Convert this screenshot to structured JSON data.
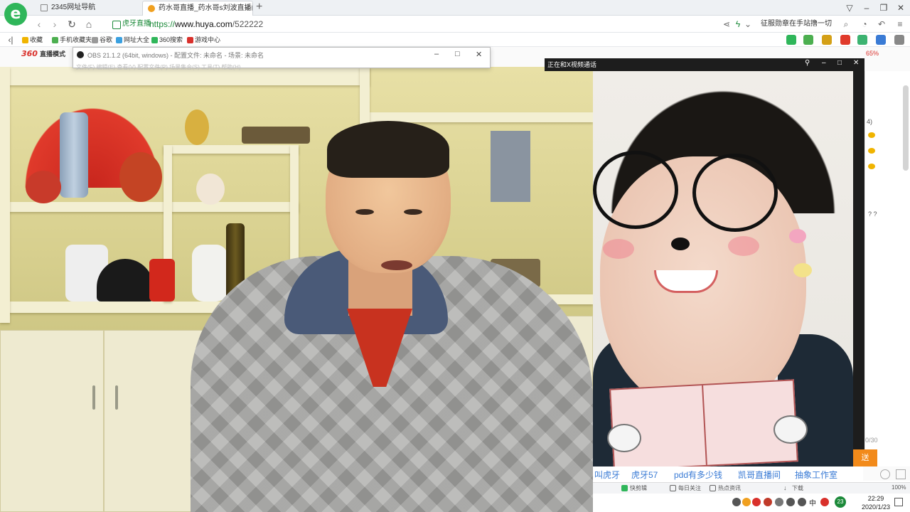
{
  "tabs": [
    {
      "label": "2345网址导航"
    },
    {
      "label": "药水哥直播_药水哥s刘波直播间_"
    }
  ],
  "address": {
    "site_badge": "虎牙直播",
    "url_scheme": "https://",
    "url_domain": "www.huya.com",
    "url_path": "/522222",
    "right_text": "征服勋章在手站撸一切"
  },
  "bookmarks": [
    {
      "label": "收藏"
    },
    {
      "label": "手机收藏夹"
    },
    {
      "label": "谷歌"
    },
    {
      "label": "网址大全"
    },
    {
      "label": "360搜索"
    },
    {
      "label": "游戏中心"
    }
  ],
  "page": {
    "logo": "360",
    "logo_sub": "直播模式",
    "percent": "65%"
  },
  "obs": {
    "title": "OBS 21.1.2 (64bit, windows) - 配置文件: 未命名 - 场景: 未命名",
    "menu": "文件(F)  编辑(E)  查看(V)  配置文件(P)  场景集合(S)  工具(T)  帮助(H)"
  },
  "video_chat": {
    "title": "正在和X视频通话"
  },
  "live_links": [
    "叫虎牙",
    "虎牙57",
    "pdd有多少钱",
    "凯哥直播间",
    "抽象工作室"
  ],
  "gift_label": "送",
  "side_text": {
    "count": "4)",
    "qmarks": "? ?",
    "page_ratio": "0/30"
  },
  "statusbar": {
    "items": [
      "快剪辑",
      "每日关注",
      "热点资讯",
      "下载"
    ],
    "zoom": "100%"
  },
  "taskbar": {
    "ime": "中",
    "badge": "23",
    "time": "22:29",
    "date": "2020/1/23"
  }
}
